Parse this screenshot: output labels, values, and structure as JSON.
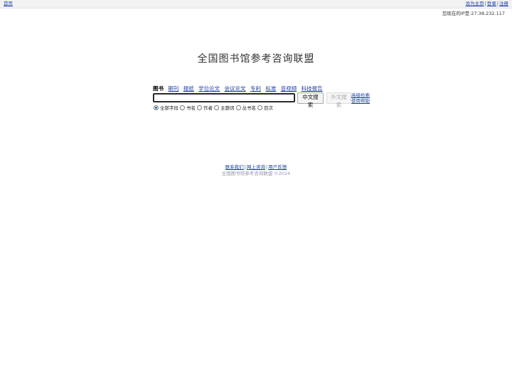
{
  "topbar": {
    "home": "首页",
    "set_home": "设为主页",
    "login": "登录",
    "register": "注册",
    "sep": "|"
  },
  "ip_text": "您现在的IP是:27.38.232.117",
  "logo_text": "全国图书馆参考咨询联盟",
  "tabs": [
    {
      "label": "图书",
      "active": true
    },
    {
      "label": "期刊",
      "active": false
    },
    {
      "label": "报纸",
      "active": false
    },
    {
      "label": "学位论文",
      "active": false
    },
    {
      "label": "会议论文",
      "active": false
    },
    {
      "label": "专利",
      "active": false
    },
    {
      "label": "标准",
      "active": false
    },
    {
      "label": "音视频",
      "active": false
    },
    {
      "label": "科技报告",
      "active": false
    }
  ],
  "search": {
    "value": "",
    "placeholder": "",
    "btn_chinese": "中文搜索",
    "btn_foreign": "外文搜索"
  },
  "side_links": {
    "advanced": "高级检索",
    "help": "使用帮助"
  },
  "options": [
    {
      "label": "全部字段",
      "checked": true
    },
    {
      "label": "书名",
      "checked": false
    },
    {
      "label": "作者",
      "checked": false
    },
    {
      "label": "主题词",
      "checked": false
    },
    {
      "label": "丛书名",
      "checked": false
    },
    {
      "label": "目次",
      "checked": false
    }
  ],
  "footer": {
    "contact": "联系我们",
    "consult": "网上咨询",
    "feedback": "用户反馈",
    "sep": "|",
    "copyright": "全国图书馆参考咨询联盟 ©2024"
  }
}
